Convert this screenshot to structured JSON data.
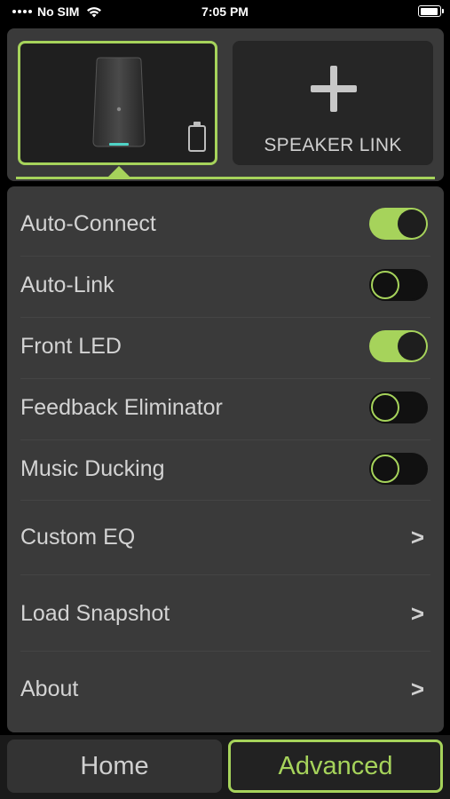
{
  "status_bar": {
    "carrier": "No SIM",
    "time": "7:05 PM",
    "battery_level": 0.95
  },
  "speaker_panel": {
    "selected_speaker": {
      "icon": "speaker-icon",
      "battery_icon": "battery-icon"
    },
    "link_button": {
      "icon": "plus-icon",
      "label": "SPEAKER LINK"
    }
  },
  "settings": {
    "toggles": [
      {
        "label": "Auto-Connect",
        "on": true
      },
      {
        "label": "Auto-Link",
        "on": false
      },
      {
        "label": "Front LED",
        "on": true
      },
      {
        "label": "Feedback Eliminator",
        "on": false
      },
      {
        "label": "Music Ducking",
        "on": false
      }
    ],
    "links": [
      {
        "label": "Custom EQ",
        "chevron": ">"
      },
      {
        "label": "Load Snapshot",
        "chevron": ">"
      },
      {
        "label": "About",
        "chevron": ">"
      }
    ]
  },
  "tabs": {
    "home": "Home",
    "advanced": "Advanced",
    "active": "advanced"
  },
  "colors": {
    "accent": "#a6d35b",
    "panel": "#3a3a3a",
    "background": "#000000"
  }
}
